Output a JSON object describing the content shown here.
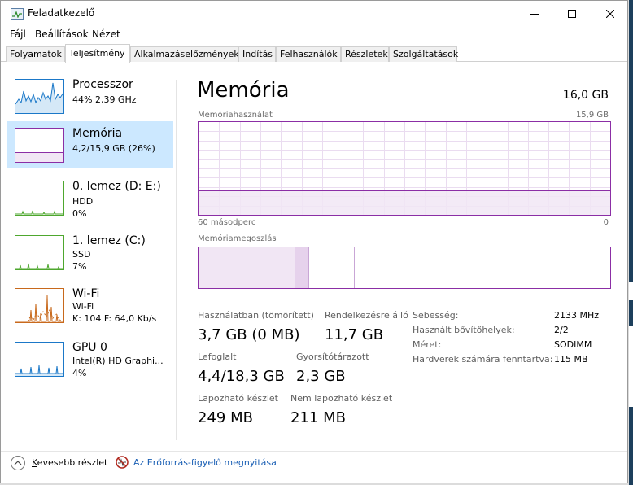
{
  "window": {
    "title": "Feladatkezelő",
    "controls": [
      "minimize",
      "maximize",
      "close"
    ]
  },
  "menu": [
    "Fájl",
    "Beállítások",
    "Nézet"
  ],
  "tabs": [
    {
      "label": "Folyamatok",
      "active": false
    },
    {
      "label": "Teljesítmény",
      "active": true
    },
    {
      "label": "Alkalmazáselőzmények",
      "active": false
    },
    {
      "label": "Indítás",
      "active": false
    },
    {
      "label": "Felhasználók",
      "active": false
    },
    {
      "label": "Részletek",
      "active": false
    },
    {
      "label": "Szolgáltatások",
      "active": false
    }
  ],
  "sidebar": {
    "items": [
      {
        "name": "Processzor",
        "lines": [
          "44% 2,39 GHz"
        ],
        "color": "#1b78c8",
        "selected": false
      },
      {
        "name": "Memória",
        "lines": [
          "4,2/15,9 GB (26%)"
        ],
        "color": "#8b2ea5",
        "selected": true
      },
      {
        "name": "0. lemez (D: E:)",
        "lines": [
          "HDD",
          "0%"
        ],
        "color": "#4ea72e",
        "selected": false
      },
      {
        "name": "1. lemez (C:)",
        "lines": [
          "SSD",
          "7%"
        ],
        "color": "#4ea72e",
        "selected": false
      },
      {
        "name": "Wi-Fi",
        "lines": [
          "Wi-Fi",
          "K: 104 F: 64,0 Kb/s"
        ],
        "color": "#c8691c",
        "selected": false
      },
      {
        "name": "GPU 0",
        "lines": [
          "Intel(R) HD Graphi...",
          "4%"
        ],
        "color": "#1b78c8",
        "selected": false
      }
    ]
  },
  "main": {
    "title": "Memória",
    "total": "16,0 GB",
    "usage_graph": {
      "label": "Memóriahasználat",
      "max_label": "15,9 GB",
      "time_label": "60 másodperc",
      "zero_label": "0",
      "used_fraction": 0.26,
      "color": "#8b2ea5"
    },
    "composition": {
      "label": "Memóriamegoszlás",
      "in_use_fraction": 0.233,
      "modified_fraction": 0.033,
      "standby_fraction": 0.111
    },
    "stats": {
      "in_use_label": "Használatban (tömörített)",
      "in_use_value": "3,7 GB (0 MB)",
      "available_label": "Rendelkezésre álló",
      "available_value": "11,7 GB",
      "committed_label": "Lefoglalt",
      "committed_value": "4,4/18,3 GB",
      "cached_label": "Gyorsítótárazott",
      "cached_value": "2,3 GB",
      "paged_label": "Lapozható készlet",
      "paged_value": "249 MB",
      "nonpaged_label": "Nem lapozható készlet",
      "nonpaged_value": "211 MB"
    },
    "details": [
      {
        "label": "Sebesség:",
        "value": "2133 MHz"
      },
      {
        "label": "Használt bővítőhelyek:",
        "value": "2/2"
      },
      {
        "label": "Méret:",
        "value": "SODIMM"
      },
      {
        "label": "Hardverek számára fenntartva:",
        "value": "115 MB"
      }
    ]
  },
  "footer": {
    "fewer_details_prefix": "K",
    "fewer_details_rest": "evesebb részlet",
    "resmon_link": "Az Erőforrás-figyelő megnyitása"
  }
}
